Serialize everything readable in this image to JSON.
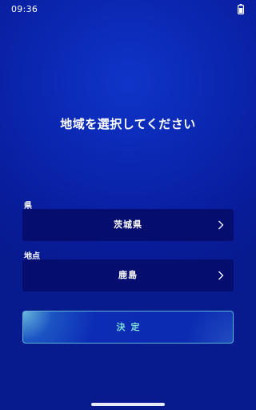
{
  "status_bar": {
    "time": "09:36",
    "battery_icon": "battery-icon"
  },
  "title": "地域を選択してください",
  "prefecture": {
    "label": "県",
    "value": "茨城県",
    "icon": "chevron-right-icon"
  },
  "location": {
    "label": "地点",
    "value": "鹿島",
    "icon": "chevron-right-icon"
  },
  "confirm_button": {
    "label": "決定"
  },
  "colors": {
    "background": "#0b27b2",
    "field_background": "#050d6e",
    "button_border": "#5fb3d9",
    "button_text": "#7fe0d8"
  }
}
